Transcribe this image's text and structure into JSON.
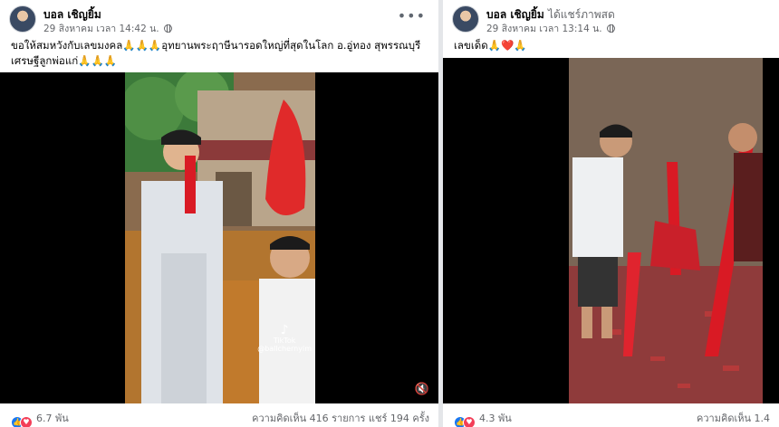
{
  "left_post": {
    "author": "บอล เชิญยิ้ม",
    "timestamp": "29 สิงหาคม เวลา 14:42 น.",
    "caption": "ขอให้สมหวังกับเลขมงคล🙏🙏🙏อุทยานพระฤาษีนารอดใหญ่ที่สุดในโลก อ.อู่ทอง สุพรรณบุรี เศรษฐีลูกพ่อแก่🙏🙏🙏",
    "reaction_count": "6.7 พัน",
    "stats": "ความคิดเห็น 416 รายการ  แชร์ 194 ครั้ง",
    "tiktok_label": "TikTok",
    "tiktok_handle": "@ballchernyim"
  },
  "right_post": {
    "author": "บอล เชิญยิ้ม",
    "shared_text": "ได้แชร์ภาพสด",
    "timestamp": "29 สิงหาคม เวลา 13:14 น.",
    "caption": "เลขเด็ด🙏❤️🙏",
    "reaction_count": "4.3 พัน",
    "stats": "ความคิดเห็น 1.4"
  },
  "icons": {
    "more": "more-options-icon",
    "privacy": "globe-icon",
    "like": "like-reaction-icon",
    "love": "love-reaction-icon",
    "mute": "speaker-muted-icon",
    "tiktok": "tiktok-logo"
  },
  "colors": {
    "accent": "#1877f2",
    "love": "#f33e58",
    "ribbon": "#d91a24"
  }
}
